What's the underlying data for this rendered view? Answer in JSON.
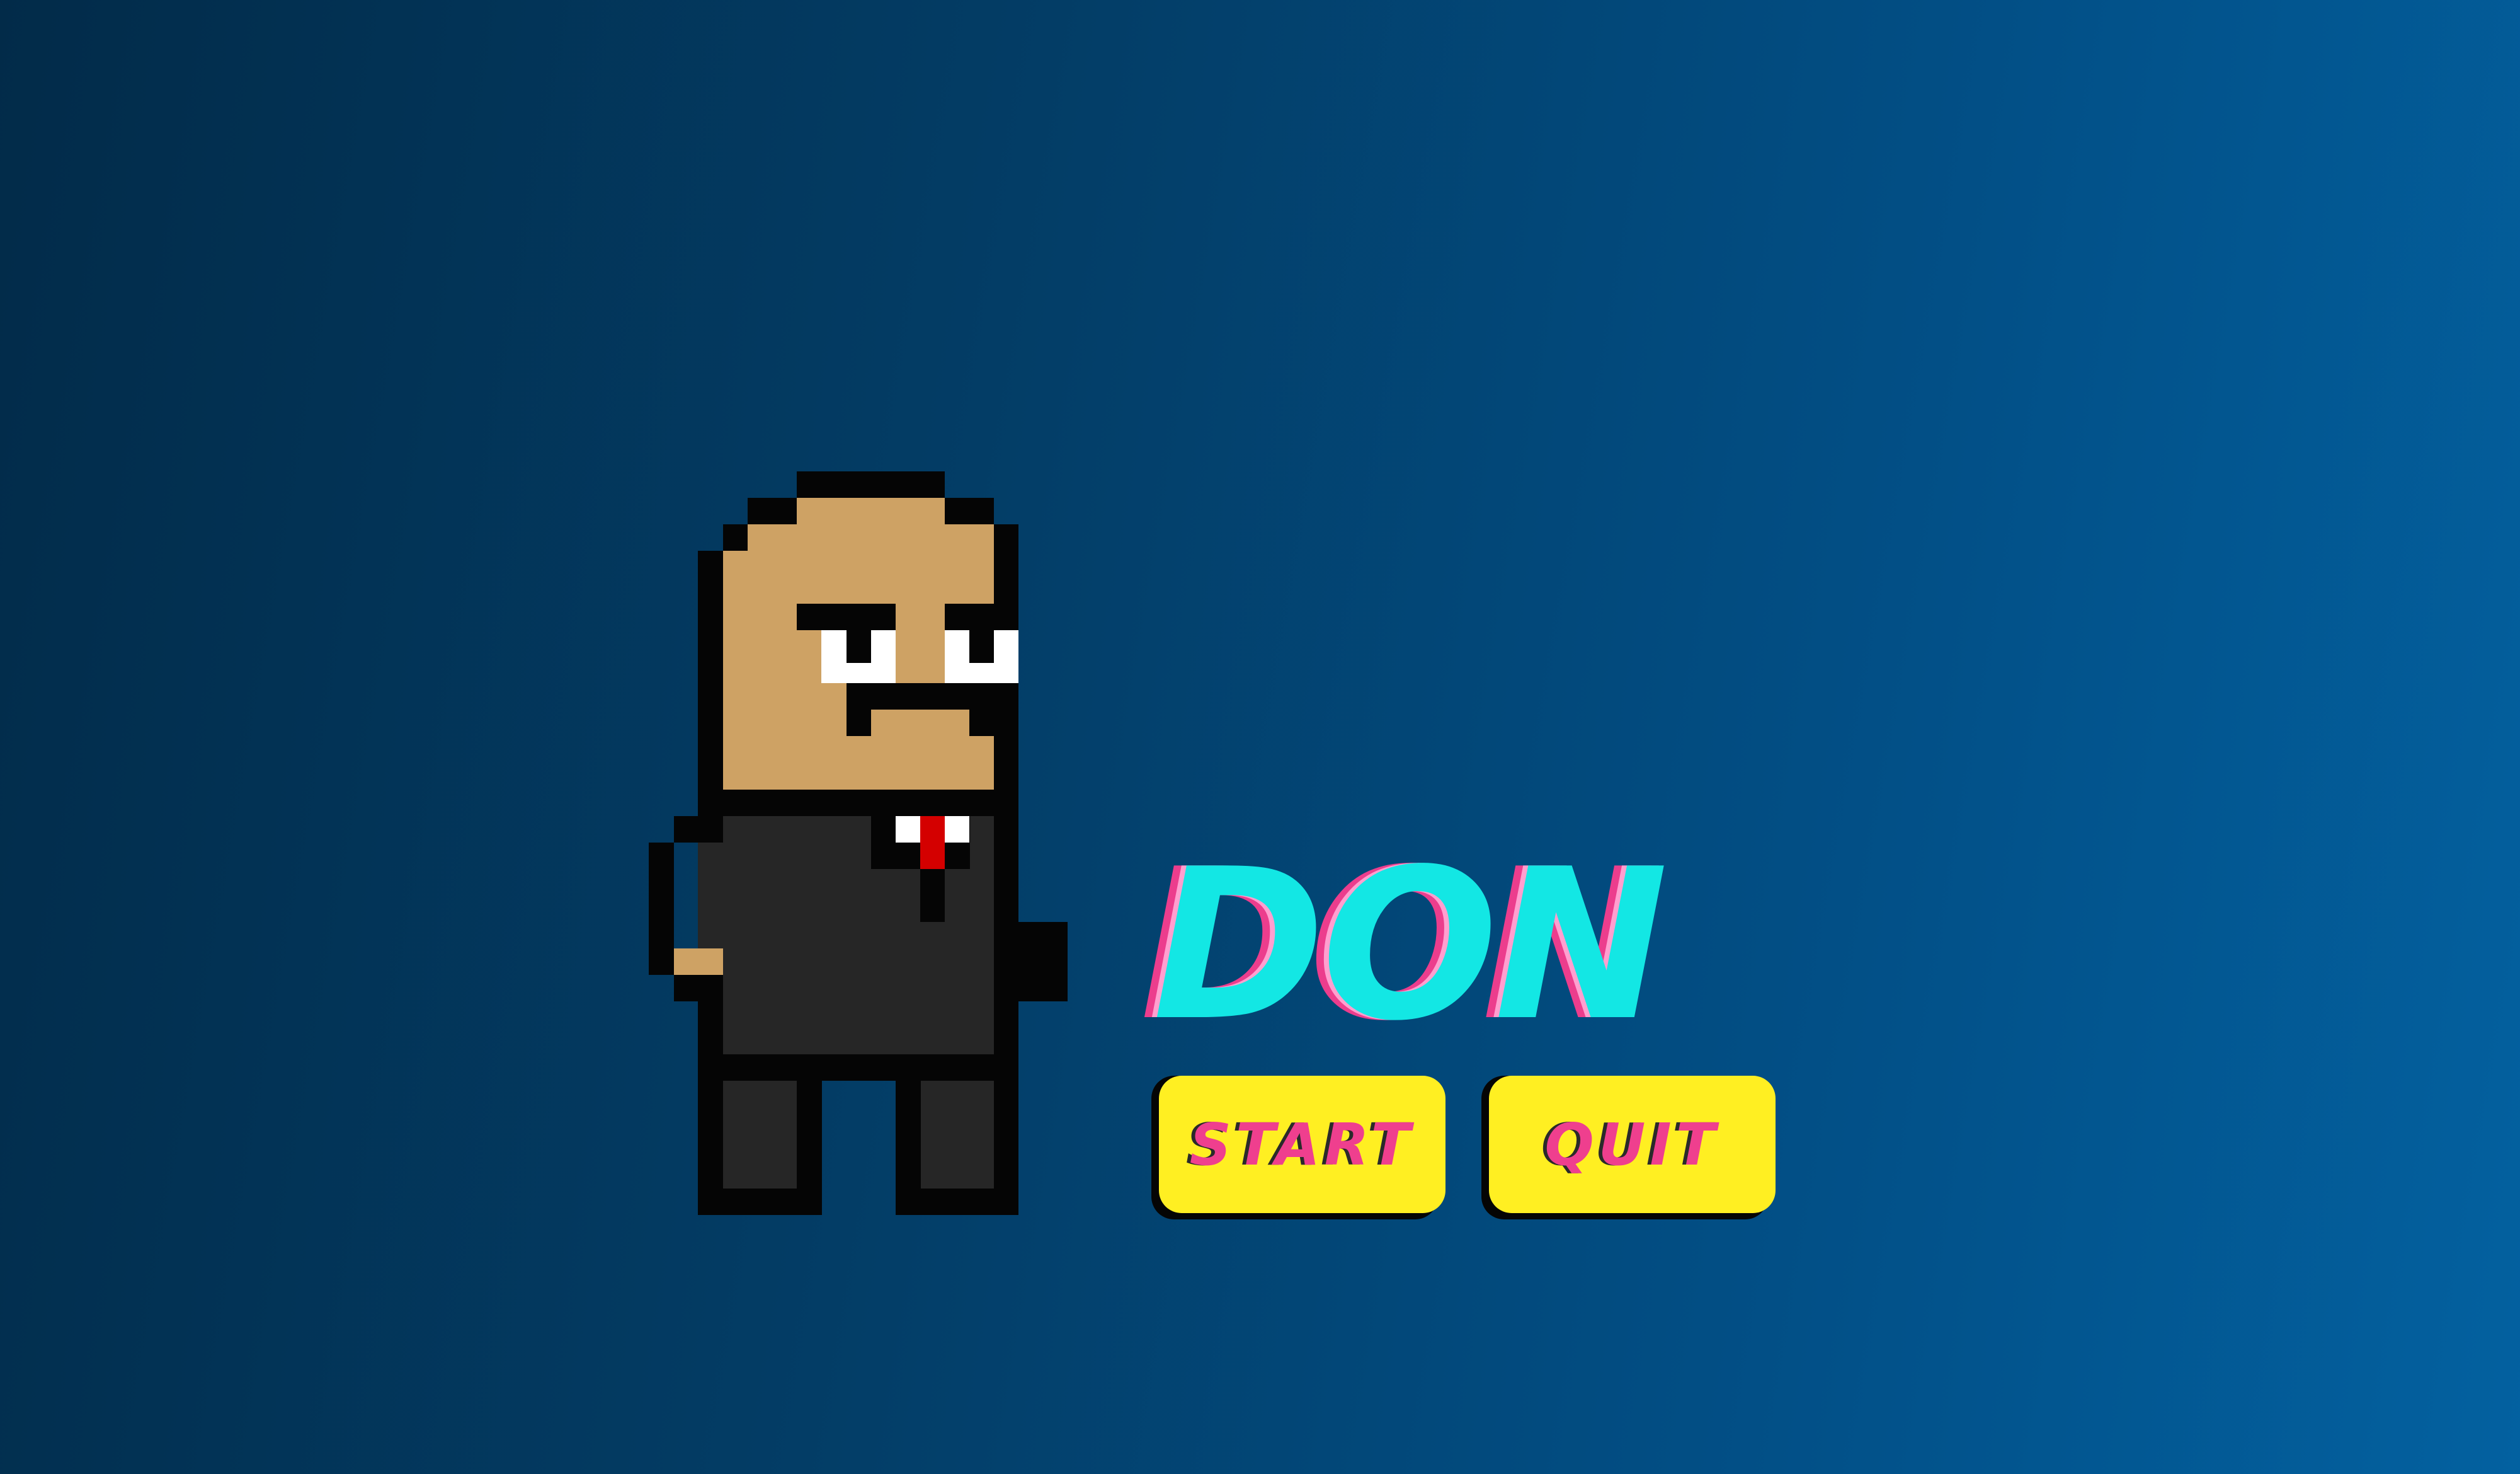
{
  "screen": {
    "background_colors": [
      "#022b49",
      "#0361a0"
    ]
  },
  "character": {
    "name": "don-pixel-character",
    "colors": {
      "skin": "#cea264",
      "suit": "#262626",
      "outline": "#050505",
      "eyes": "#ffffff",
      "tie": "#d40000"
    }
  },
  "title": {
    "text": "DON",
    "color": "#13e7e4",
    "shadow_colors": [
      "#ec3d8d",
      "#ff9fcf"
    ]
  },
  "menu": {
    "start_label": "START",
    "quit_label": "QUIT",
    "button_color": "#ffef22",
    "label_color": "#ef3f8e"
  }
}
